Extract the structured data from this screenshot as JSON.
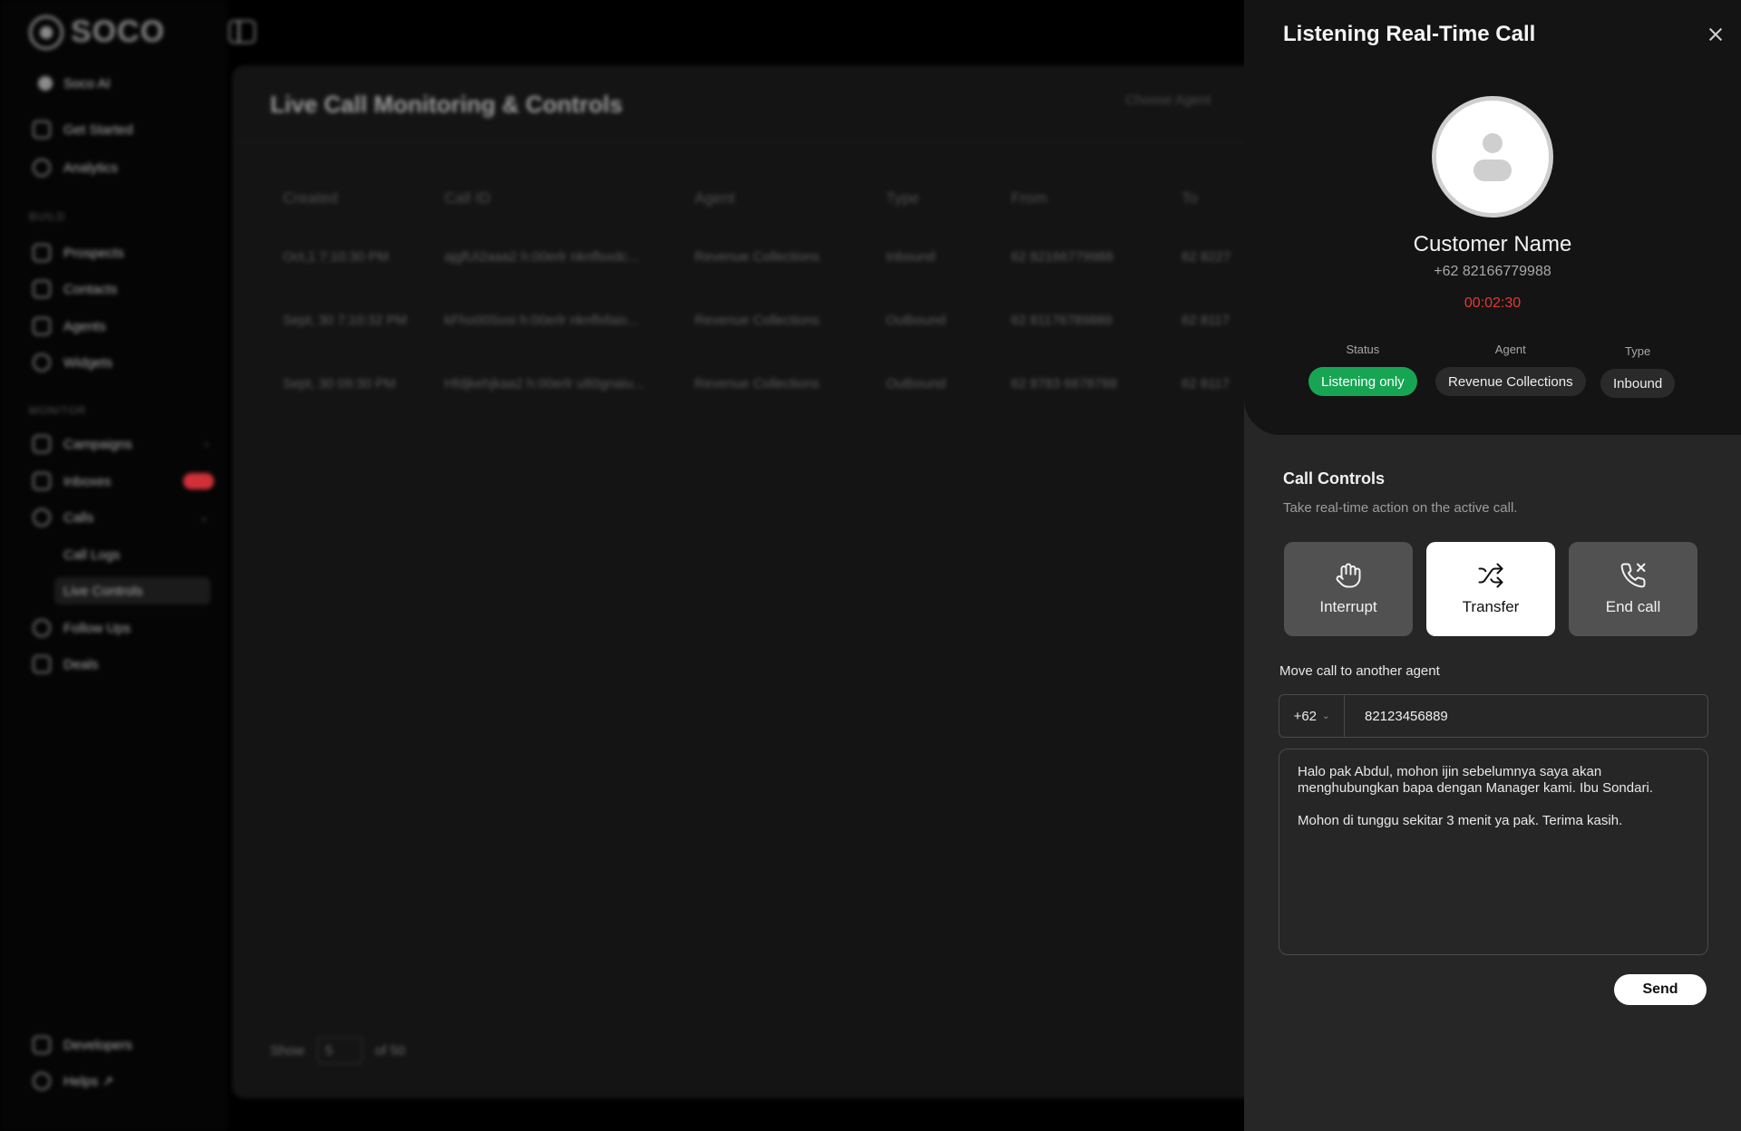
{
  "app": {
    "logo_text": "SOCO",
    "workspace": "Soco AI"
  },
  "sidebar": {
    "top_items": [
      {
        "label": "Get Started",
        "icon": "rocket-icon"
      },
      {
        "label": "Analytics",
        "icon": "chart-icon"
      }
    ],
    "section_build": "BUILD",
    "build_items": [
      {
        "label": "Prospects",
        "icon": "users-icon"
      },
      {
        "label": "Contacts",
        "icon": "contacts-icon"
      },
      {
        "label": "Agents",
        "icon": "bot-icon"
      },
      {
        "label": "Widgets",
        "icon": "widget-icon"
      }
    ],
    "section_monitor": "MONITOR",
    "monitor_items": [
      {
        "label": "Campaigns",
        "icon": "megaphone-icon"
      },
      {
        "label": "Inboxes",
        "icon": "inbox-icon"
      },
      {
        "label": "Calls",
        "icon": "phone-icon"
      },
      {
        "label": "Call Logs",
        "icon": ""
      },
      {
        "label": "Live Controls",
        "icon": ""
      },
      {
        "label": "Follow Ups",
        "icon": "followup-icon"
      },
      {
        "label": "Deals",
        "icon": "dollar-icon"
      }
    ],
    "bottom_items": [
      {
        "label": "Developers",
        "icon": "code-icon"
      },
      {
        "label": "Helps ↗",
        "icon": "help-icon"
      }
    ]
  },
  "main": {
    "title": "Live Call Monitoring & Controls",
    "choose_agent_placeholder": "Choose Agent",
    "columns": [
      "Created",
      "Call ID",
      "Agent",
      "Type",
      "From",
      "To"
    ],
    "rows": [
      [
        "Oct,1 7:10:30 PM",
        "ajgfUi2aaa2 h:00erlr nknflsxdc...",
        "Revenue Collections",
        "Inbound",
        "62 82166779988",
        "62 8227"
      ],
      [
        "Sept, 30 7:10:32 PM",
        "kFho00Sosi h:00erlr nknflsfaio...",
        "Revenue Collections",
        "Outbound",
        "62 81176789889",
        "62 8117"
      ],
      [
        "Sept, 30 09:30 PM",
        "Hfdjkehjkaa2 h:00erlr u80gnaiu...",
        "Revenue Collections",
        "Outbound",
        "62 8783 6678788",
        "62 8117"
      ]
    ],
    "footer_show": "Show",
    "footer_page": "5",
    "footer_total": "of 50"
  },
  "panel": {
    "title": "Listening Real-Time Call",
    "customer_name": "Customer Name",
    "customer_phone": "+62 82166779988",
    "timer": "00:02:30",
    "status_label": "Status",
    "status_value": "Listening only",
    "agent_label": "Agent",
    "agent_value": "Revenue Collections",
    "type_label": "Type",
    "type_value": "Inbound",
    "controls_title": "Call Controls",
    "controls_subtitle": "Take real-time action on the active call.",
    "btn_interrupt": "Interrupt",
    "btn_transfer": "Transfer",
    "btn_end_call": "End call",
    "move_label": "Move call to another agent",
    "country_code": "+62",
    "phone_value": "82123456889",
    "message_value": "Halo pak Abdul, mohon ijin sebelumnya saya akan menghubungkan bapa dengan Manager kami. Ibu Sondari.\n\nMohon di tunggu sekitar 3 menit ya pak. Terima kasih.",
    "send_label": "Send"
  },
  "colors": {
    "status_green": "#17a553",
    "timer_red": "#e53935",
    "panel_bg": "#262626",
    "panel_top_bg": "#141414"
  }
}
